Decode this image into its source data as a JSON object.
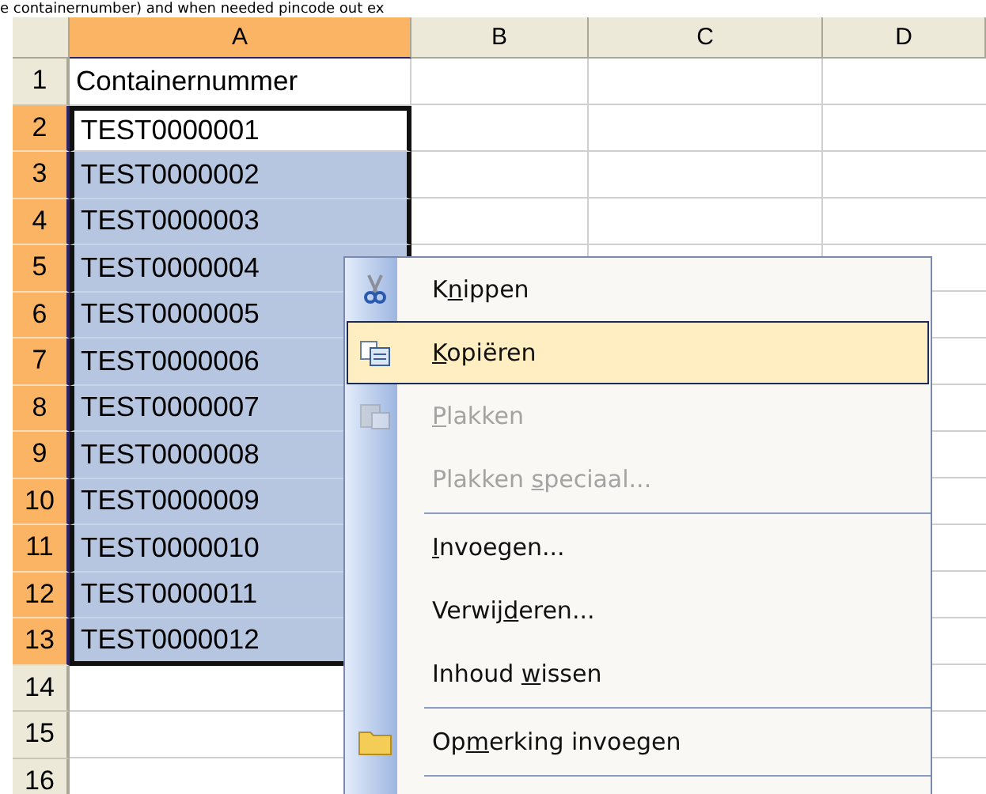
{
  "caption": "e containernumber) and when needed pincode out ex",
  "columns": [
    {
      "label": "A",
      "selected": true
    },
    {
      "label": "B",
      "selected": false
    },
    {
      "label": "C",
      "selected": false
    },
    {
      "label": "D",
      "selected": false
    }
  ],
  "rows": [
    {
      "number": "1",
      "selected": false,
      "cell": {
        "value": "Containernummer",
        "highlighted": false,
        "outlined": false
      }
    },
    {
      "number": "2",
      "selected": true,
      "cell": {
        "value": "TEST0000001",
        "highlighted": false,
        "outlined": true
      }
    },
    {
      "number": "3",
      "selected": true,
      "cell": {
        "value": "TEST0000002",
        "highlighted": true,
        "outlined": true
      }
    },
    {
      "number": "4",
      "selected": true,
      "cell": {
        "value": "TEST0000003",
        "highlighted": true,
        "outlined": true
      }
    },
    {
      "number": "5",
      "selected": true,
      "cell": {
        "value": "TEST0000004",
        "highlighted": true,
        "outlined": true
      }
    },
    {
      "number": "6",
      "selected": true,
      "cell": {
        "value": "TEST0000005",
        "highlighted": true,
        "outlined": true
      }
    },
    {
      "number": "7",
      "selected": true,
      "cell": {
        "value": "TEST0000006",
        "highlighted": true,
        "outlined": true
      }
    },
    {
      "number": "8",
      "selected": true,
      "cell": {
        "value": "TEST0000007",
        "highlighted": true,
        "outlined": true
      }
    },
    {
      "number": "9",
      "selected": true,
      "cell": {
        "value": "TEST0000008",
        "highlighted": true,
        "outlined": true
      }
    },
    {
      "number": "10",
      "selected": true,
      "cell": {
        "value": "TEST0000009",
        "highlighted": true,
        "outlined": true
      }
    },
    {
      "number": "11",
      "selected": true,
      "cell": {
        "value": "TEST0000010",
        "highlighted": true,
        "outlined": true
      }
    },
    {
      "number": "12",
      "selected": true,
      "cell": {
        "value": "TEST0000011",
        "highlighted": true,
        "outlined": true
      }
    },
    {
      "number": "13",
      "selected": true,
      "cell": {
        "value": "TEST0000012",
        "highlighted": true,
        "outlined": true
      }
    },
    {
      "number": "14",
      "selected": false
    },
    {
      "number": "15",
      "selected": false
    },
    {
      "number": "16",
      "selected": false
    }
  ],
  "context_menu": [
    {
      "kind": "item",
      "label": {
        "before": "K",
        "key": "n",
        "after": "ippen"
      },
      "disabled": false,
      "selected": false
    },
    {
      "kind": "item",
      "label": {
        "key": "K",
        "after": "opiëren"
      },
      "disabled": false,
      "selected": true
    },
    {
      "kind": "item",
      "label": {
        "key": "P",
        "after": "lakken"
      },
      "disabled": true,
      "selected": false
    },
    {
      "kind": "item",
      "label": {
        "before": "Plakken ",
        "key": "s",
        "after": "peciaal..."
      },
      "disabled": true,
      "selected": false
    },
    {
      "kind": "separator"
    },
    {
      "kind": "item",
      "label": {
        "key": "I",
        "after": "nvoegen..."
      },
      "disabled": false,
      "selected": false
    },
    {
      "kind": "item",
      "label": {
        "before": "Verwij",
        "key": "d",
        "after": "eren..."
      },
      "disabled": false,
      "selected": false
    },
    {
      "kind": "item",
      "label": {
        "before": "Inhoud ",
        "key": "w",
        "after": "issen"
      },
      "disabled": false,
      "selected": false
    },
    {
      "kind": "separator"
    },
    {
      "kind": "item",
      "label": {
        "before": "Op",
        "key": "m",
        "after": "erking invoegen"
      },
      "disabled": false,
      "selected": false
    },
    {
      "kind": "separator"
    }
  ]
}
